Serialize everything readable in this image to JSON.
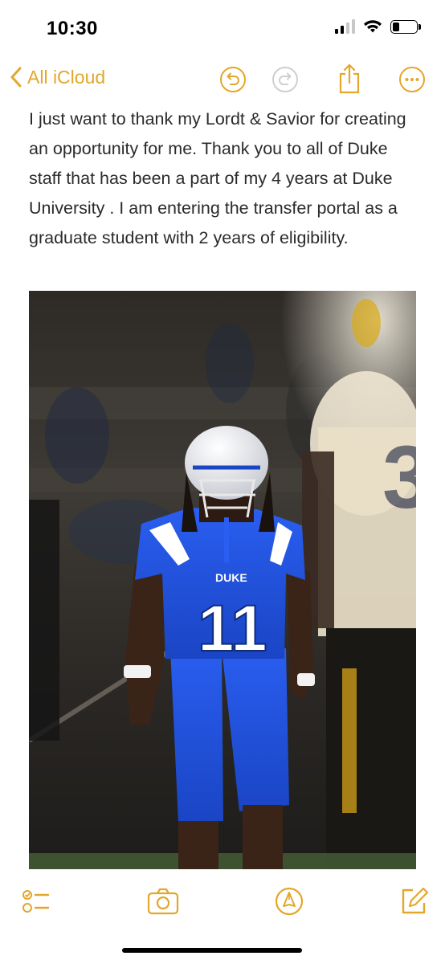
{
  "status_bar": {
    "time": "10:30",
    "signal_bars_active": 2,
    "signal_bars_total": 4,
    "battery_level": 0.3
  },
  "nav": {
    "back_label": "All iCloud",
    "back_icon": "chevron-left-icon",
    "undo_icon": "undo-icon",
    "redo_icon": "redo-icon",
    "share_icon": "share-icon",
    "more_icon": "more-icon"
  },
  "note": {
    "text": "I just want to thank my Lordt & Savior for creating an opportunity for me. Thank you to all of Duke staff that has been a part of my 4 years at Duke University . I am entering the transfer portal as a graduate student with 2 years of eligibility."
  },
  "photo": {
    "jersey_number": "11",
    "jersey_wordmark": "DUKE"
  },
  "toolbar": {
    "checklist_icon": "checklist-icon",
    "camera_icon": "camera-icon",
    "markup_icon": "markup-pen-icon",
    "compose_icon": "compose-icon"
  },
  "colors": {
    "accent": "#e3a72a",
    "text": "#2b2b2b",
    "jersey_blue": "#1c4fd8",
    "background": "#ffffff"
  }
}
